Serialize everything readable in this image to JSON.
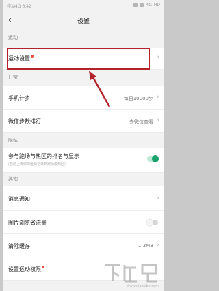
{
  "status_bar": {
    "carrier": "移动4G",
    "time": "6:42",
    "network": "4G",
    "battery": "HD"
  },
  "nav": {
    "back_icon": "chevron-left-icon",
    "title": "设置"
  },
  "sections": {
    "sport": "运动",
    "daily": "日常",
    "privacy": "隐私",
    "other": "其他"
  },
  "rows": {
    "sport_settings": {
      "label": "运动设置"
    },
    "step_counter": {
      "label": "手机计步",
      "value": "每日10000步"
    },
    "wechat_rank": {
      "label": "微信步数排行",
      "value": "去微信查看"
    },
    "hotspot_rank": {
      "label": "参与跑场与热区的排名与显示",
      "sub": "(自动上传你的运动记录到跑场或热区)",
      "on": true
    },
    "notifications": {
      "label": "消息通知"
    },
    "image_data_saver": {
      "label": "图片浏览省流量",
      "on": false
    },
    "clear_cache": {
      "label": "清除缓存",
      "value": "1.3MB"
    },
    "sport_permission": {
      "label": "设置运动权限"
    }
  },
  "colors": {
    "highlight": "#b4222c",
    "toggle_on": "#1aa36c",
    "red_dot": "#ef4b3c"
  },
  "watermark": {
    "logo_text": "下载吧",
    "url": "www.xiazaiba.com"
  }
}
